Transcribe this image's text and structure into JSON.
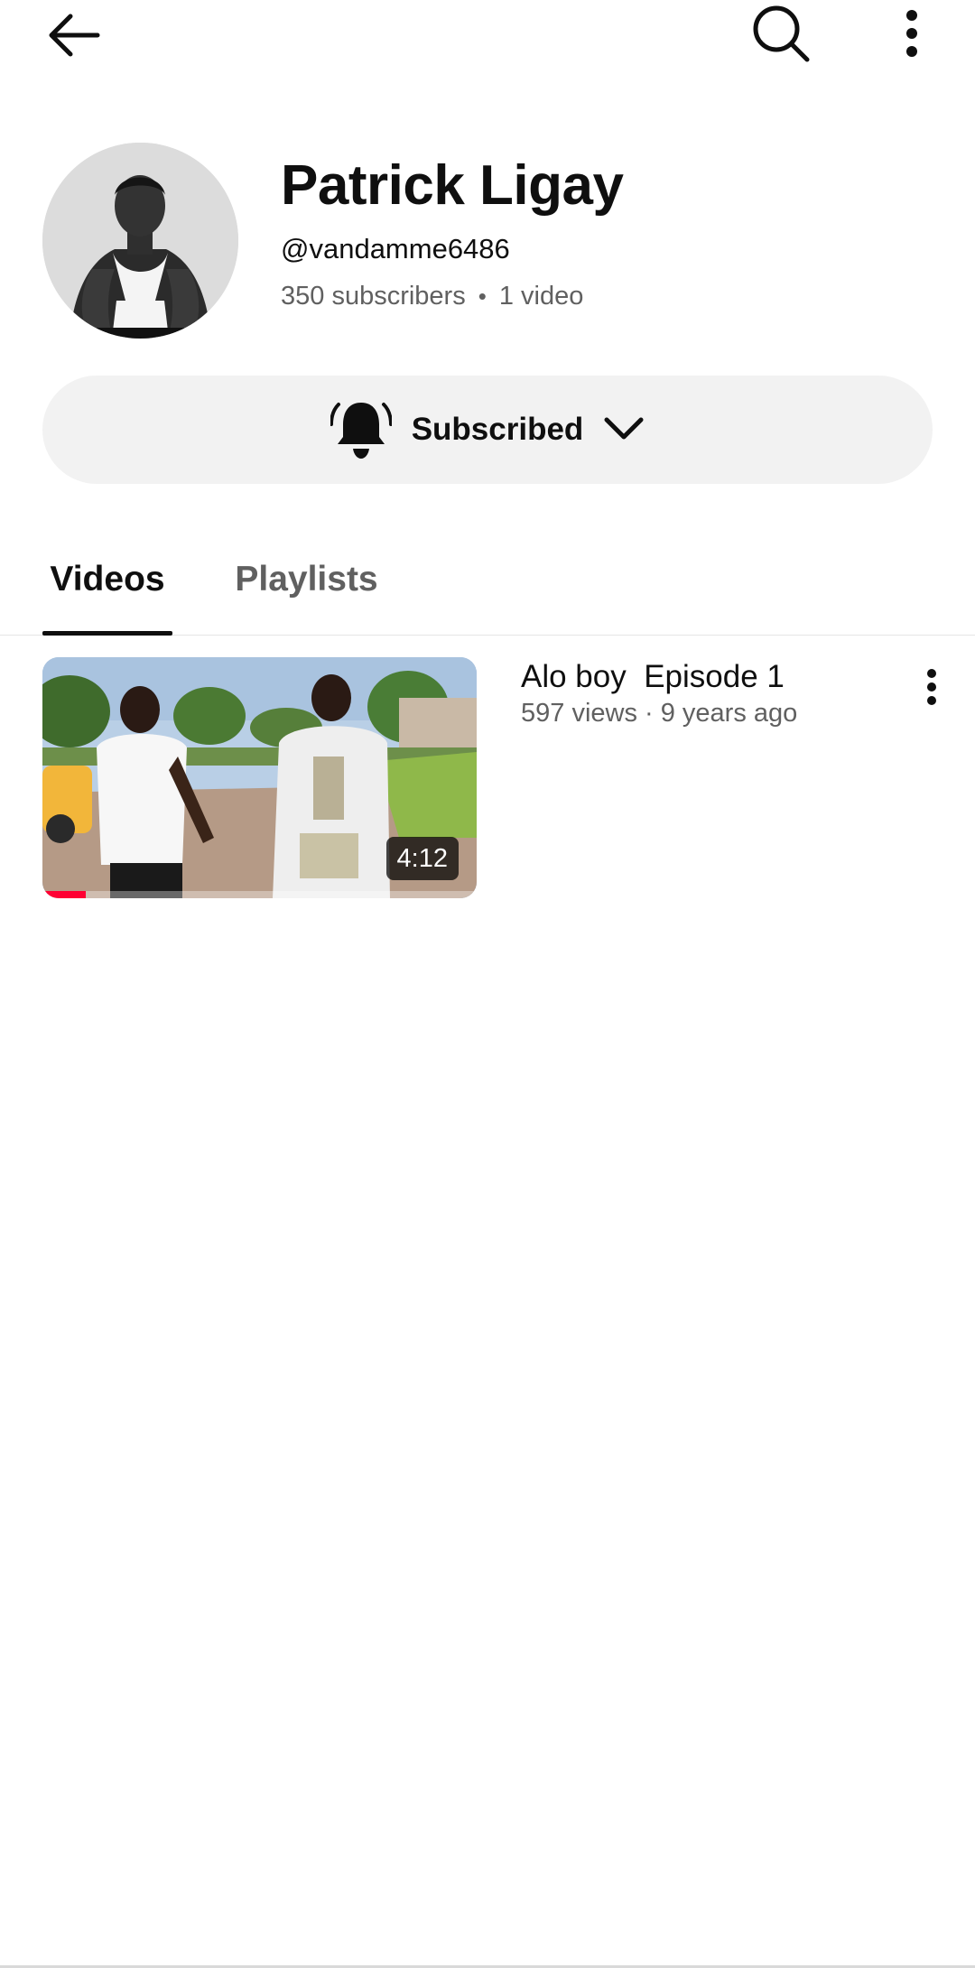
{
  "top_bar": {
    "back_icon": "arrow-left-icon",
    "search_icon": "search-icon",
    "more_icon": "more-vertical-icon"
  },
  "channel": {
    "name": "Patrick Ligay",
    "handle": "@vandamme6486",
    "subscribers": "350 subscribers",
    "separator": "•",
    "video_count": "1 video"
  },
  "subscribe": {
    "label": "Subscribed",
    "bell_icon": "bell-icon",
    "chevron_icon": "chevron-down-icon"
  },
  "tabs": [
    {
      "label": "Videos",
      "selected": true
    },
    {
      "label": "Playlists",
      "selected": false
    }
  ],
  "videos": [
    {
      "title": "Alo boy  Episode 1",
      "meta": "597 views · 9 years ago",
      "duration": "4:12",
      "watch_progress": 0.1
    }
  ],
  "colors": {
    "progress": "#ff0033",
    "subscribe_bg": "#f2f2f2",
    "secondary_text": "#606060"
  }
}
